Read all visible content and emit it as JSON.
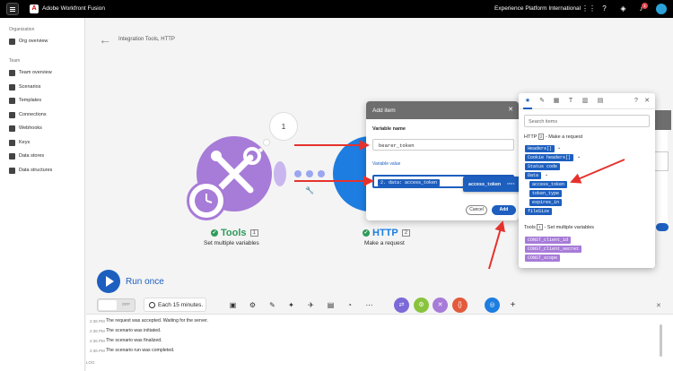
{
  "topbar": {
    "app_title": "Adobe Workfront Fusion",
    "org_name": "Experience Platform International",
    "notification_count": "1"
  },
  "sidebar": {
    "org_section": "Organization",
    "org_overview": "Org overview",
    "team_section": "Team",
    "items": [
      {
        "label": "Team overview"
      },
      {
        "label": "Scenarios"
      },
      {
        "label": "Templates"
      },
      {
        "label": "Connections"
      },
      {
        "label": "Webhooks"
      },
      {
        "label": "Keys"
      },
      {
        "label": "Data stores"
      },
      {
        "label": "Data structures"
      }
    ]
  },
  "canvas": {
    "breadcrumb": "Integration Tools, HTTP",
    "bubble_count": "1",
    "tools_module": {
      "name": "Tools",
      "number": "1",
      "subtitle": "Set multiple variables"
    },
    "http_module": {
      "name": "HTTP",
      "number": "2",
      "subtitle": "Make a request"
    }
  },
  "run": {
    "label": "Run once",
    "toggle_state": "OFF",
    "schedule": "Each 15 minutes."
  },
  "log": {
    "rows": [
      {
        "time": "2:36 PM",
        "text": "The request was accepted. Waiting for the server."
      },
      {
        "time": "2:36 PM",
        "text": "The scenario was initiated."
      },
      {
        "time": "2:36 PM",
        "text": "The scenario was finalized."
      },
      {
        "time": "2:36 PM",
        "text": "The scenario run was completed."
      }
    ],
    "tag": "LOG"
  },
  "dialog": {
    "title": "Add item",
    "variable_name_label": "Variable name",
    "variable_name_value": "bearer_token",
    "variable_value_label": "Variable value",
    "variable_value_chip": "2. data: access_token",
    "cancel_label": "Cancel",
    "add_label": "Add"
  },
  "tooltip": {
    "name": "access_token",
    "type": "Text"
  },
  "panel": {
    "search_placeholder": "Search items",
    "http_group": {
      "module": "HTTP",
      "number": "2",
      "suffix": "- Make a request"
    },
    "http_items": [
      "Headers[]",
      "Cookie headers[]",
      "Status code",
      "Data",
      "access_token",
      "token_type",
      "expires_in",
      "fileSize"
    ],
    "tools_group": {
      "module": "Tools",
      "number": "1",
      "suffix": "- Set multiple variables"
    },
    "tools_items": [
      "CONST_client_id",
      "CONST_client_secret",
      "CONST_scope"
    ]
  },
  "colors": {
    "accent_blue": "#1d5fbf",
    "module_purple": "#a77bd8",
    "success_green": "#2e9b5a",
    "annotation_red": "#e5322d"
  }
}
